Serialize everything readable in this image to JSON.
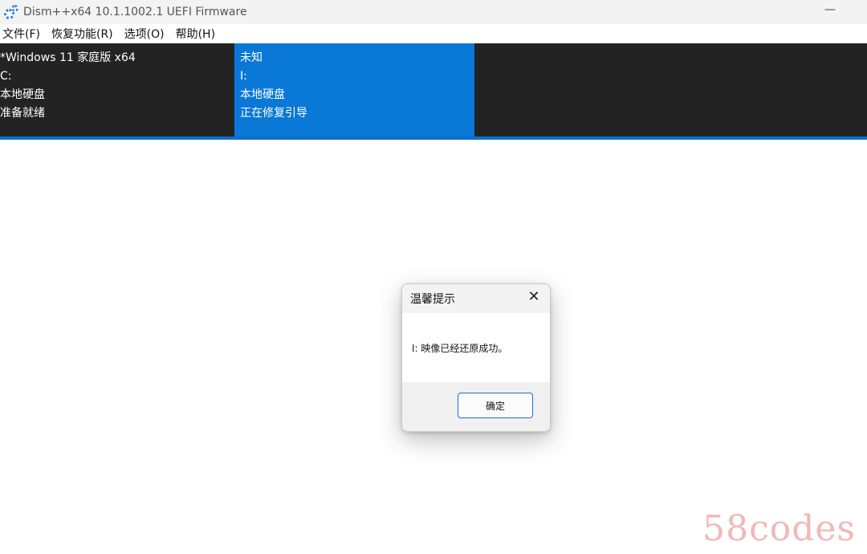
{
  "window": {
    "title": "Dism++x64 10.1.1002.1 UEFI Firmware",
    "minimize": "—"
  },
  "menu": [
    {
      "label": "文件(F)"
    },
    {
      "label": "恢复功能(R)"
    },
    {
      "label": "选项(O)"
    },
    {
      "label": "帮助(H)"
    }
  ],
  "cards": [
    {
      "lines": [
        "*Windows 11 家庭版 x64",
        "C:",
        "本地硬盘",
        "准备就绪"
      ]
    },
    {
      "lines": [
        "未知",
        "I:",
        "本地硬盘",
        "正在修复引导"
      ]
    }
  ],
  "dialog": {
    "title": "温馨提示",
    "close": "✕",
    "message": "I: 映像已经还原成功。",
    "ok": "确定"
  },
  "watermark": "58codes",
  "colors": {
    "panel_bg": "#232323",
    "selected_card": "#0a78d7",
    "accent_line": "#0a6fcc"
  }
}
